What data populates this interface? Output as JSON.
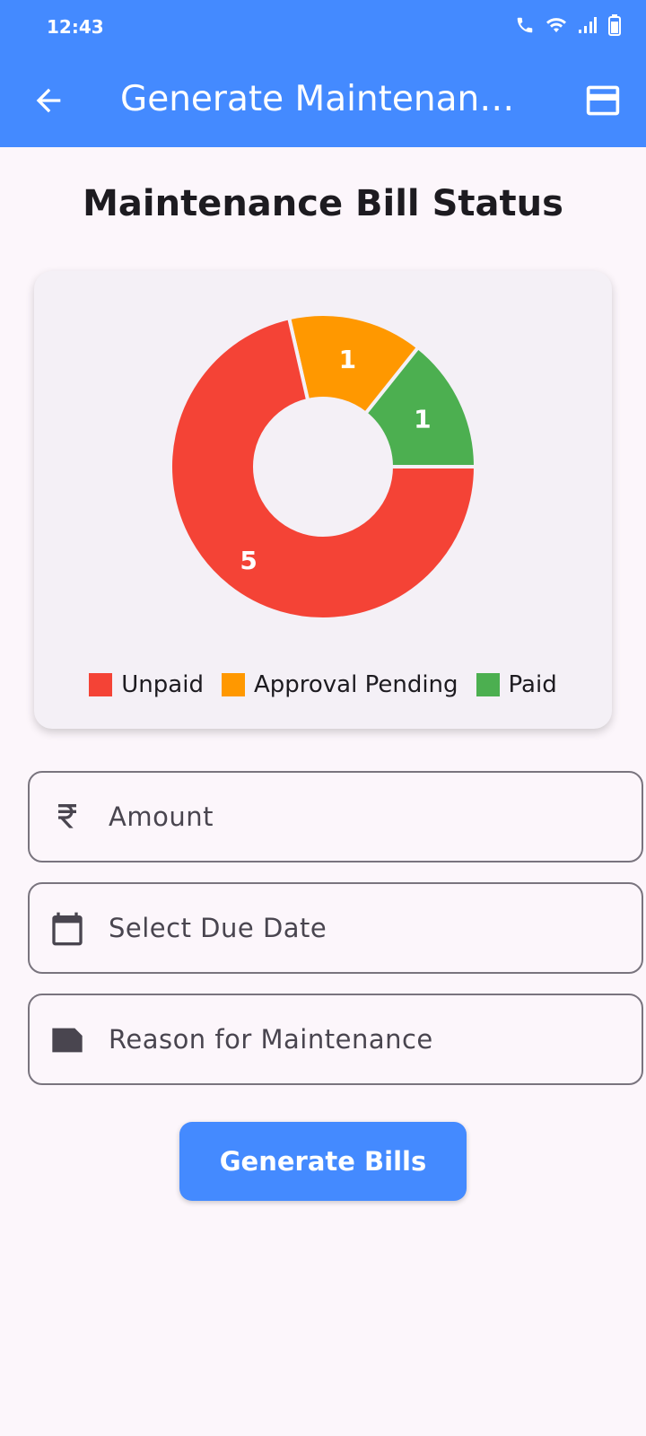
{
  "status_bar": {
    "time": "12:43"
  },
  "app_bar": {
    "title": "Generate Maintenance Bills"
  },
  "page": {
    "title": "Maintenance Bill Status"
  },
  "chart_data": {
    "type": "pie",
    "title": "",
    "labels": [
      "Unpaid",
      "Approval Pending",
      "Paid"
    ],
    "values": [
      5,
      1,
      1
    ],
    "colors": [
      "#f44336",
      "#ff9800",
      "#4caf50"
    ],
    "donut": true,
    "legend": "bottom"
  },
  "legend": [
    {
      "label": "Unpaid",
      "color": "#f44336"
    },
    {
      "label": "Approval Pending",
      "color": "#ff9800"
    },
    {
      "label": "Paid",
      "color": "#4caf50"
    }
  ],
  "form": {
    "amount_placeholder": "Amount",
    "due_date_placeholder": "Select Due Date",
    "reason_placeholder": "Reason for Maintenance",
    "submit_label": "Generate Bills"
  },
  "icons": {
    "back": "arrow-back-icon",
    "card": "credit-card-icon",
    "amount": "rupee-icon",
    "date": "calendar-icon",
    "reason": "note-icon"
  },
  "theme": {
    "primary": "#448aff",
    "background": "#fcf6fb",
    "card": "#f4f0f6"
  }
}
